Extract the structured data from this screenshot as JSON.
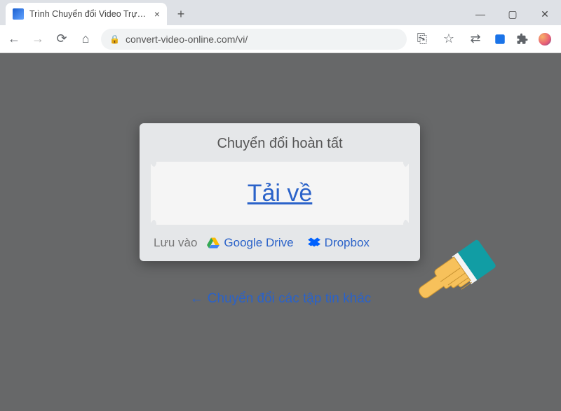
{
  "browser": {
    "tab_title": "Trình Chuyển đổi Video Trực tuyế",
    "url": "convert-video-online.com/vi/"
  },
  "card": {
    "title": "Chuyển đổi hoàn tất",
    "download": "Tải về",
    "save_label": "Lưu vào",
    "gdrive": "Google Drive",
    "dropbox": "Dropbox"
  },
  "below": {
    "text": "Chuyển đổi các tập tin khác"
  }
}
